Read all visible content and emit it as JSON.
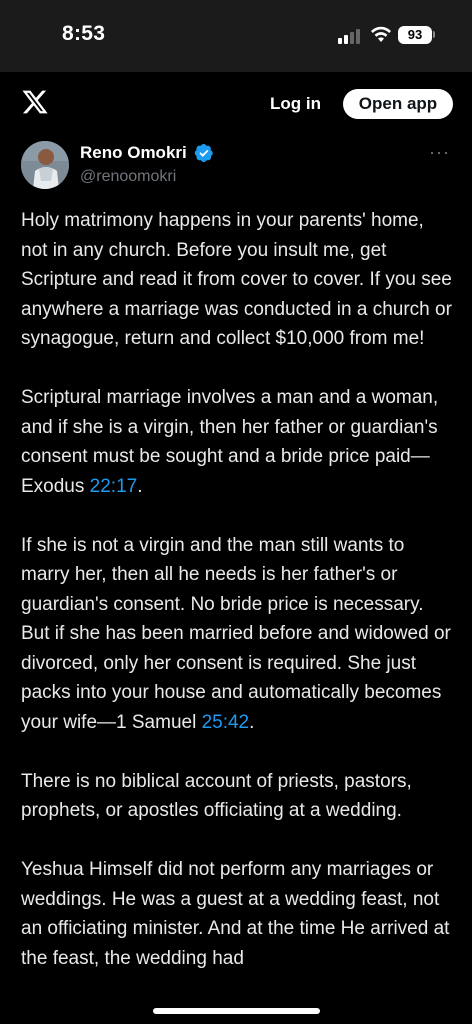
{
  "status_bar": {
    "time": "8:53",
    "battery": "93",
    "signal_icon": "cellular-signal-icon",
    "wifi_icon": "wifi-icon"
  },
  "nav": {
    "logo_icon": "x-logo-icon",
    "login_label": "Log in",
    "open_app_label": "Open app"
  },
  "post": {
    "author_name": "Reno Omokri",
    "verified_icon": "verified-badge-icon",
    "author_handle": "@renoomokri",
    "more_label": "···",
    "paragraphs": [
      {
        "text": "Holy matrimony happens in your parents' home, not in any church. Before you insult me, get Scripture and read it from cover to cover. If you see anywhere a marriage was conducted in a church or synagogue, return and collect $10,000 from me!"
      },
      {
        "text": "Scriptural marriage involves a man and a woman, and if she is a virgin, then her father or guardian's consent must be sought and a bride price paid—Exodus ",
        "link": "22:17",
        "after": "."
      },
      {
        "text": "If she is not a virgin and the man still wants to marry her, then all he needs is her father's or guardian's consent. No bride price is necessary. But if she has been married before and widowed or divorced, only her consent is required. She just packs into your house and automatically becomes your wife—1 Samuel ",
        "link": "25:42",
        "after": "."
      },
      {
        "text": "There is no biblical account of priests, pastors, prophets, or apostles officiating at a wedding."
      },
      {
        "text": "Yeshua Himself did not perform any marriages or weddings. He was a guest at a wedding feast, not an officiating minister. And at the time He arrived at the feast, the wedding had"
      }
    ]
  },
  "colors": {
    "background": "#000000",
    "text": "#e7e9ea",
    "link": "#1d9bf0",
    "secondary": "#71767b"
  }
}
